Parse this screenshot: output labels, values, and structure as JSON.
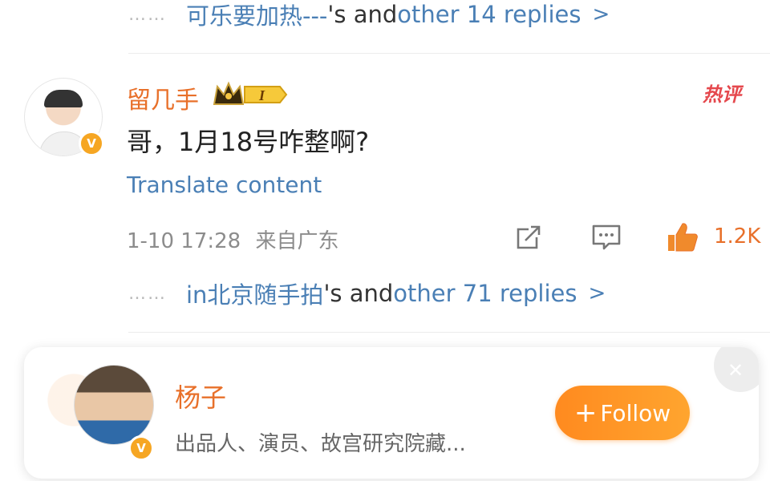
{
  "threads": [
    {
      "dots": "……",
      "user": "可乐要加热---",
      "mid": "'s and ",
      "tail": "other 14 replies",
      "chevron": ">"
    },
    {
      "dots": "……",
      "user": "in北京随手拍",
      "mid": "'s and ",
      "tail": "other 71 replies",
      "chevron": ">"
    }
  ],
  "comment": {
    "username": "留几手",
    "level_badge": "I",
    "hot_label": "热评",
    "text": "哥，1月18号咋整啊?",
    "translate": "Translate content",
    "timestamp": "1-10 17:28",
    "source": "来自广东",
    "likes": "1.2K",
    "verified_badge": "V",
    "icons": [
      "share-icon",
      "comment-icon",
      "like-icon"
    ]
  },
  "follow_card": {
    "name": "杨子",
    "bio": "出品人、演员、故宫研究院藏...",
    "follow_label": "Follow",
    "follow_plus": "+",
    "verified_badge": "V",
    "close_glyph": "✕"
  },
  "colors": {
    "accent_orange": "#e8702a",
    "link_blue": "#4a7fb5",
    "hot_red": "#e5484d",
    "follow_gradient_start": "#ff8a1f"
  }
}
